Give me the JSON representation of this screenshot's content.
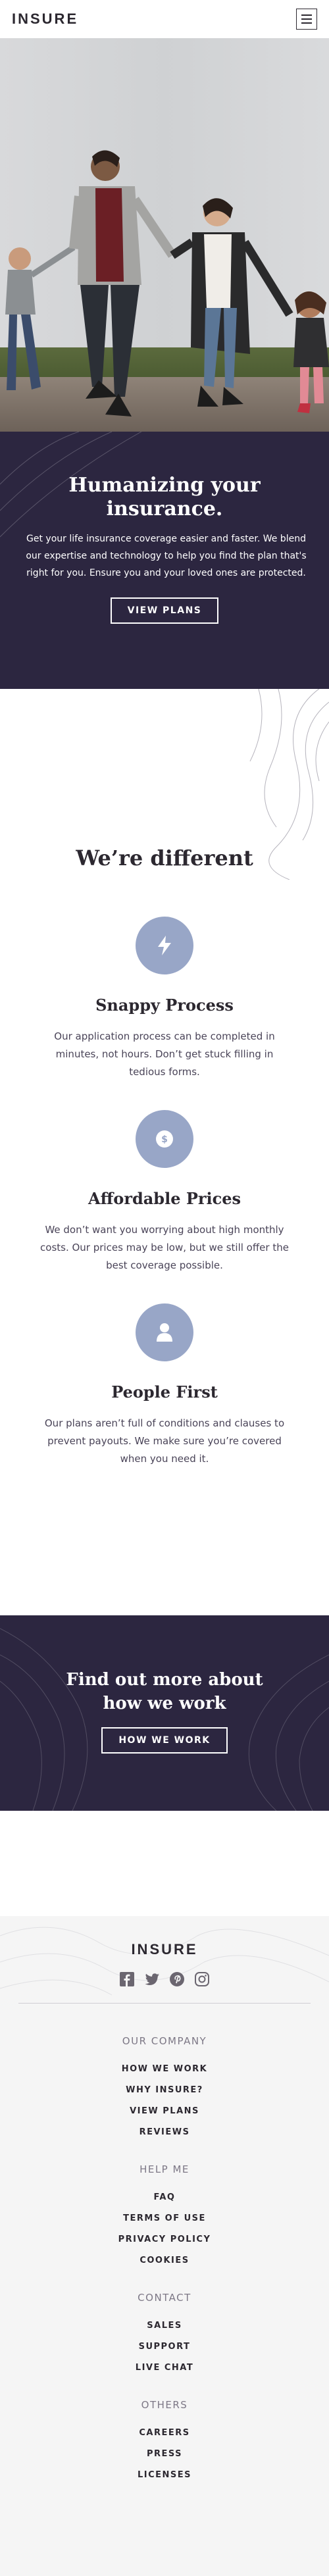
{
  "header": {
    "logo": "INSURE",
    "menu_icon": "hamburger-icon"
  },
  "hero": {
    "title": "Humanizing your insurance.",
    "description": "Get your life insurance coverage easier and faster. We blend our expertise and technology to help you find the plan that's right for you. Ensure you and your loved ones are protected.",
    "button_label": "VIEW PLANS",
    "bg_color": "#2c2640"
  },
  "different": {
    "title": "We’re different",
    "features": [
      {
        "icon": "lightning-icon",
        "title": "Snappy Process",
        "text": "Our application process can be completed in minutes, not hours. Don’t get stuck filling in tedious forms."
      },
      {
        "icon": "dollar-coin-icon",
        "title": "Affordable Prices",
        "text": "We don’t want you worrying about high monthly costs. Our prices may be low, but we still offer the best coverage possible."
      },
      {
        "icon": "person-icon",
        "title": "People First",
        "text": "Our plans aren’t full of conditions and clauses to prevent payouts. We make sure you’re covered when you need it."
      }
    ],
    "icon_bg_color": "#98a6c7"
  },
  "cta": {
    "title": "Find out more about how we work",
    "button_label": "HOW WE WORK"
  },
  "footer": {
    "logo": "INSURE",
    "socials": [
      "facebook-icon",
      "twitter-icon",
      "pinterest-icon",
      "instagram-icon"
    ],
    "columns": [
      {
        "heading": "OUR COMPANY",
        "links": [
          "HOW WE WORK",
          "WHY INSURE?",
          "VIEW PLANS",
          "REVIEWS"
        ]
      },
      {
        "heading": "HELP ME",
        "links": [
          "FAQ",
          "TERMS OF USE",
          "PRIVACY POLICY",
          "COOKIES"
        ]
      },
      {
        "heading": "CONTACT",
        "links": [
          "SALES",
          "SUPPORT",
          "LIVE CHAT"
        ]
      },
      {
        "heading": "OTHERS",
        "links": [
          "CAREERS",
          "PRESS",
          "LICENSES"
        ]
      }
    ]
  }
}
